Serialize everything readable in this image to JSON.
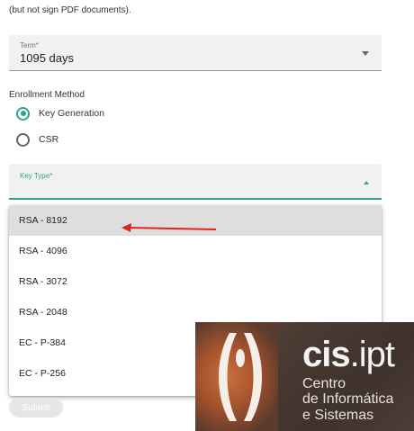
{
  "intro_text": "(but not sign PDF documents).",
  "term": {
    "label": "Term*",
    "value": "1095 days"
  },
  "enrollment": {
    "label": "Enrollment Method",
    "options": [
      {
        "label": "Key Generation",
        "selected": true
      },
      {
        "label": "CSR",
        "selected": false
      }
    ]
  },
  "key_type": {
    "label": "Key Type*",
    "options": [
      "RSA - 8192",
      "RSA - 4096",
      "RSA - 3072",
      "RSA - 2048",
      "EC - P-384",
      "EC - P-256"
    ],
    "highlighted": "RSA - 8192"
  },
  "submit_label": "Submit",
  "logo": {
    "brand_bold": "cis",
    "brand_rest": ".ipt",
    "line1": "Centro",
    "line2": "de Informática",
    "line3": "e Sistemas"
  },
  "colors": {
    "accent": "#2ea58a",
    "annotation_arrow": "#e0241b"
  }
}
